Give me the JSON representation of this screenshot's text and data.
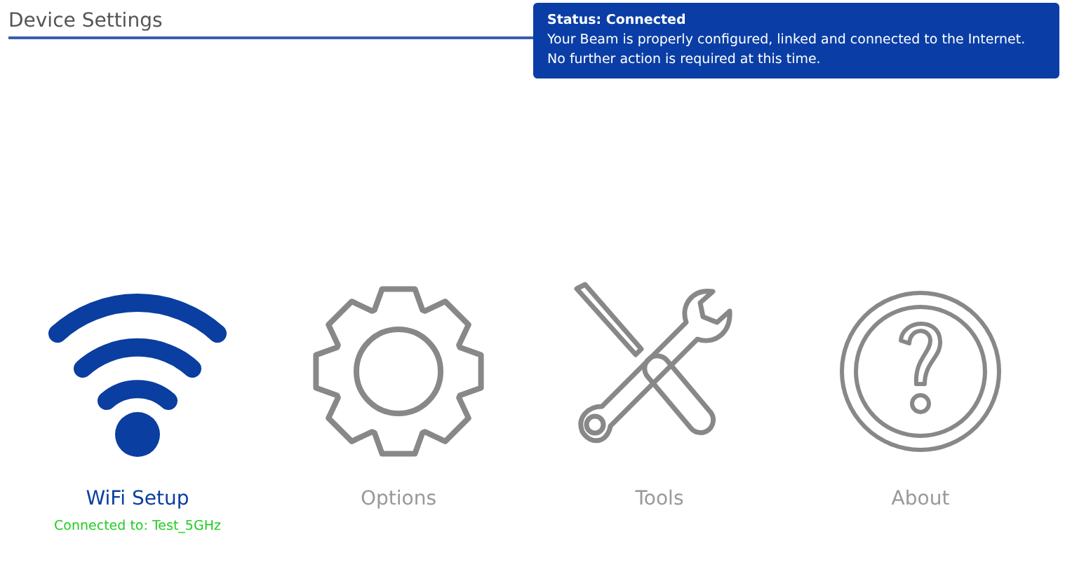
{
  "page": {
    "title": "Device Settings"
  },
  "status_tooltip": {
    "title": "Status: Connected",
    "lines": [
      "Your Beam is properly configured, linked and connected to the Internet.",
      "No further action is required at this time."
    ]
  },
  "tiles": [
    {
      "kind": "wifi",
      "label": "WiFi Setup",
      "selected": true,
      "status": "Connected to: Test_5GHz"
    },
    {
      "kind": "gear",
      "label": "Options",
      "selected": false
    },
    {
      "kind": "tools",
      "label": "Tools",
      "selected": false
    },
    {
      "kind": "about",
      "label": "About",
      "selected": false
    }
  ]
}
